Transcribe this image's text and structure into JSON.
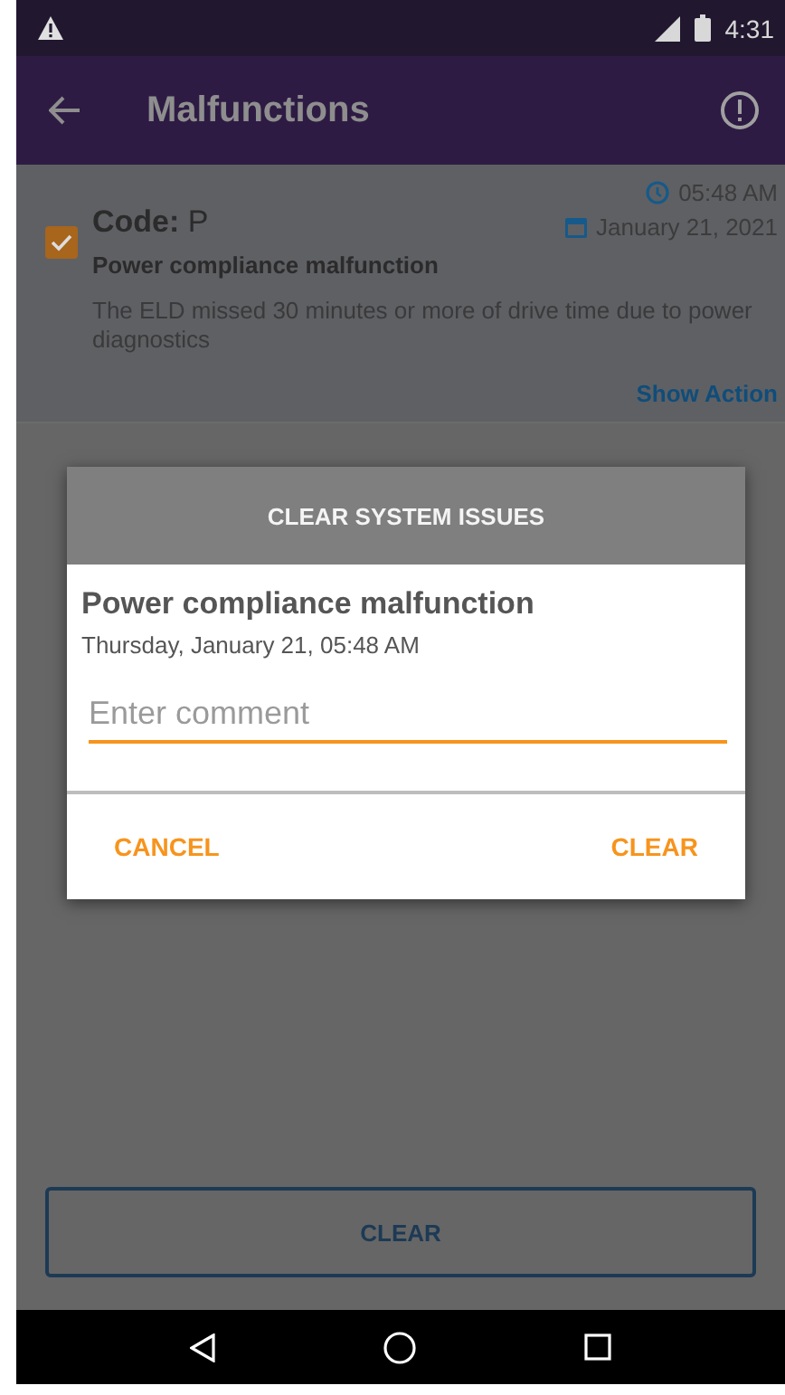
{
  "status_bar": {
    "time": "4:31"
  },
  "app_bar": {
    "title": "Malfunctions"
  },
  "malfunctions": [
    {
      "code": "**Code:** P",
      "checked": true,
      "time": "05:48 AM",
      "date": "January 21, 2021",
      "name": "Power compliance malfunction",
      "description": "The ELD missed 30 minutes or more of drive time due to power diagnostics",
      "action": "Show Action"
    }
  ],
  "dialog": {
    "title": "CLEAR SYSTEM ISSUES",
    "heading": "Power compliance malfunction",
    "datetime": "Thursday, January 21, 05:48 AM",
    "comment": {
      "placeholder": "Enter comment"
    },
    "buttons": [
      "CANCEL",
      "CLEAR"
    ]
  },
  "bottom_button": "CLEAR"
}
